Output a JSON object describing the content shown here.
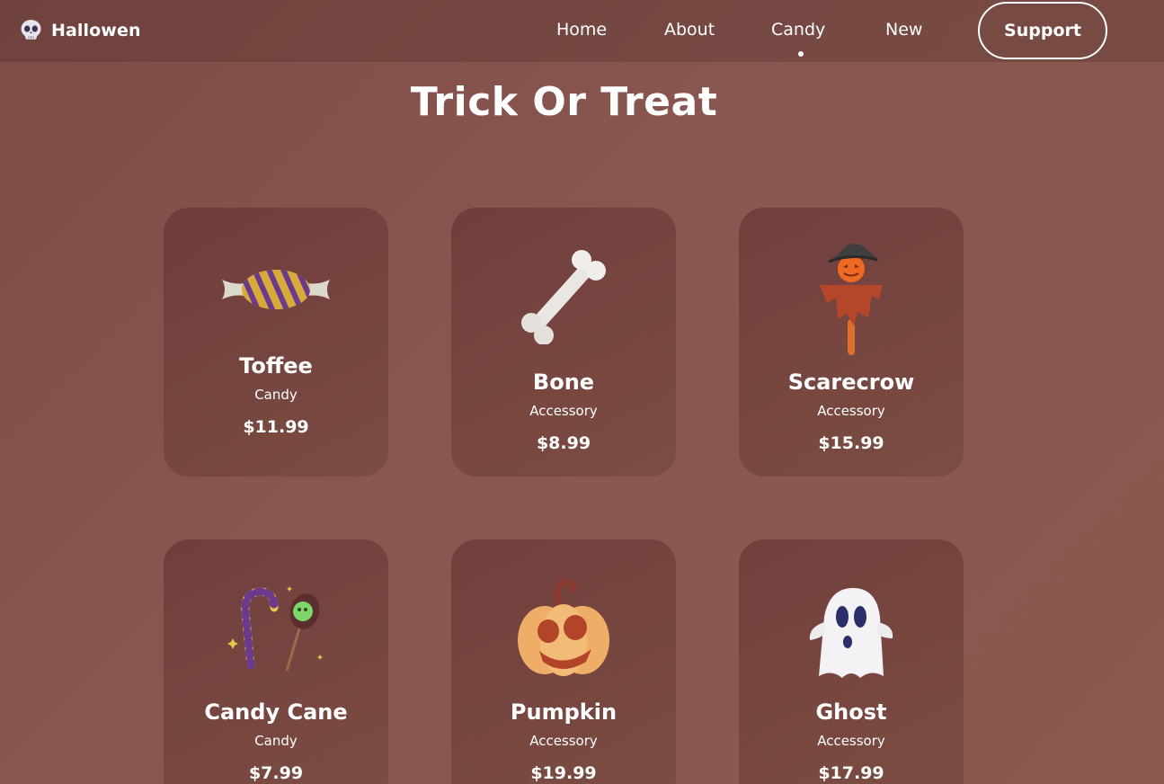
{
  "header": {
    "brand": "Hallowen",
    "brand_icon": "skull-icon",
    "nav": [
      {
        "label": "Home"
      },
      {
        "label": "About"
      },
      {
        "label": "Candy",
        "active": true
      },
      {
        "label": "New"
      }
    ],
    "support_label": "Support"
  },
  "main": {
    "title": "Trick Or Treat"
  },
  "products": [
    {
      "name": "Toffee",
      "category": "Candy",
      "price": "$11.99",
      "icon": "toffee-icon"
    },
    {
      "name": "Bone",
      "category": "Accessory",
      "price": "$8.99",
      "icon": "bone-icon"
    },
    {
      "name": "Scarecrow",
      "category": "Accessory",
      "price": "$15.99",
      "icon": "scarecrow-icon"
    },
    {
      "name": "Candy Cane",
      "category": "Candy",
      "price": "$7.99",
      "icon": "candy-cane-icon"
    },
    {
      "name": "Pumpkin",
      "category": "Accessory",
      "price": "$19.99",
      "icon": "pumpkin-icon"
    },
    {
      "name": "Ghost",
      "category": "Accessory",
      "price": "$17.99",
      "icon": "ghost-icon"
    }
  ],
  "colors": {
    "background": "#855149",
    "card": "#6b3f3c",
    "text": "#ffffff"
  }
}
